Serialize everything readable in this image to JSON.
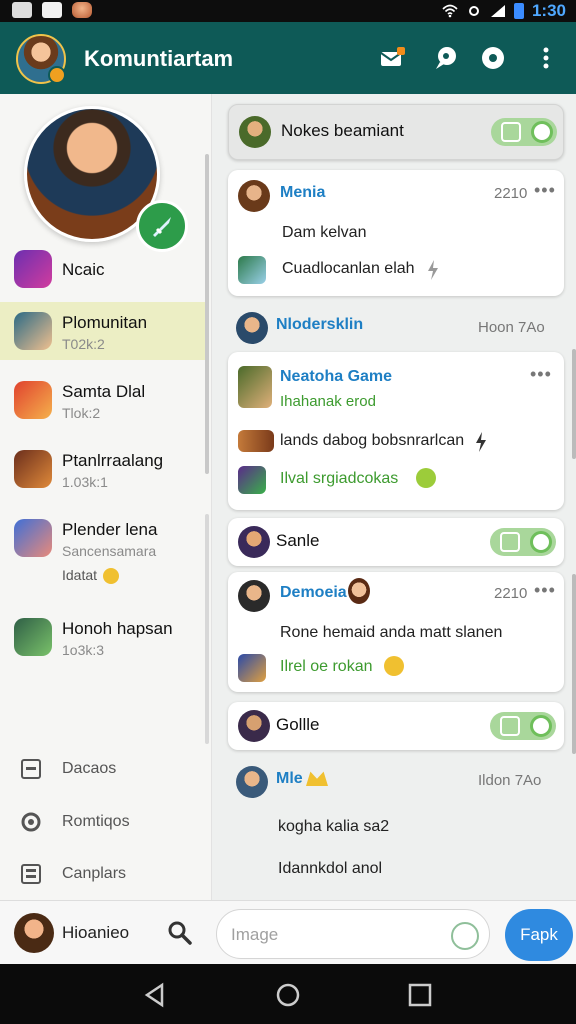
{
  "status_bar": {
    "time": "1:30",
    "icons": [
      "notification-icon",
      "mail-icon",
      "app-avatar-icon",
      "wifi-icon",
      "settings-icon",
      "signal-icon",
      "battery-icon"
    ]
  },
  "header": {
    "title": "Komuntiartam",
    "actions": [
      "mail-badge-icon",
      "chat-bubble-icon",
      "record-icon",
      "more-vert-icon"
    ]
  },
  "sidebar": {
    "items": [
      {
        "name": "Ncaic",
        "sub": "",
        "colors": [
          "#6c2fb0",
          "#d23c9e"
        ]
      },
      {
        "name": "Plomunitan",
        "sub": "T02k:2",
        "colors": [
          "#2b6a85",
          "#f0c08f"
        ]
      },
      {
        "name": "Samta Dlal",
        "sub": "Tlok:2",
        "colors": [
          "#e0422e",
          "#f5b14c"
        ]
      },
      {
        "name": "Ptanlrraalang",
        "sub": "1.03k:1",
        "colors": [
          "#6b2e1c",
          "#e08a3a"
        ]
      },
      {
        "name": "Plender lena",
        "sub": "Sancensamara",
        "sub2": "Idatat",
        "colors": [
          "#3f6fd6",
          "#e98a7a"
        ]
      },
      {
        "name": "Honoh hapsan",
        "sub": "1o3k:3",
        "colors": [
          "#2f5f46",
          "#7ac26a"
        ]
      }
    ],
    "nav": [
      {
        "label": "Dacaos",
        "icon": "archive-icon"
      },
      {
        "label": "Romtiqos",
        "icon": "settings-ring-icon"
      },
      {
        "label": "Canplars",
        "icon": "calendar-icon"
      }
    ]
  },
  "chats": {
    "group1": {
      "title": "Nokes beamiant"
    },
    "msg1": {
      "name": "Menia",
      "time": "2210",
      "more": "•••",
      "line1": "Dam kelvan",
      "line2": "Cuadlocanlan elah"
    },
    "header2": {
      "name": "Nlodersklin",
      "time": "Hoon 7Ao"
    },
    "msg2": {
      "name": "Neatoha Game",
      "sub": "Ihahanak erod",
      "more": "•••",
      "line1": "lands dabog bobsnrarlcan",
      "line2": "Ilval srgiadcokas"
    },
    "group2": {
      "title": "Sanle"
    },
    "msg3": {
      "name": "Demoeia",
      "time": "2210",
      "more": "•••",
      "line1": "Rone hemaid anda matt slanen",
      "line2": "Ilrel oe rokan"
    },
    "group3": {
      "title": "Gollle"
    },
    "msg4": {
      "name": "Mle",
      "time": "Ildon 7Ao",
      "line1": "kogha kalia sa2",
      "line2": "Idannkdol anol"
    }
  },
  "bottom": {
    "user_name": "Hioanieo",
    "input_placeholder": "Image",
    "send_label": "Fapk"
  },
  "colors": {
    "header": "#0e5a57",
    "accent_blue": "#2f8ae0",
    "name_blue": "#1e7fc4",
    "toggle_green": "#a9d79b",
    "active_row": "#eceec4"
  }
}
